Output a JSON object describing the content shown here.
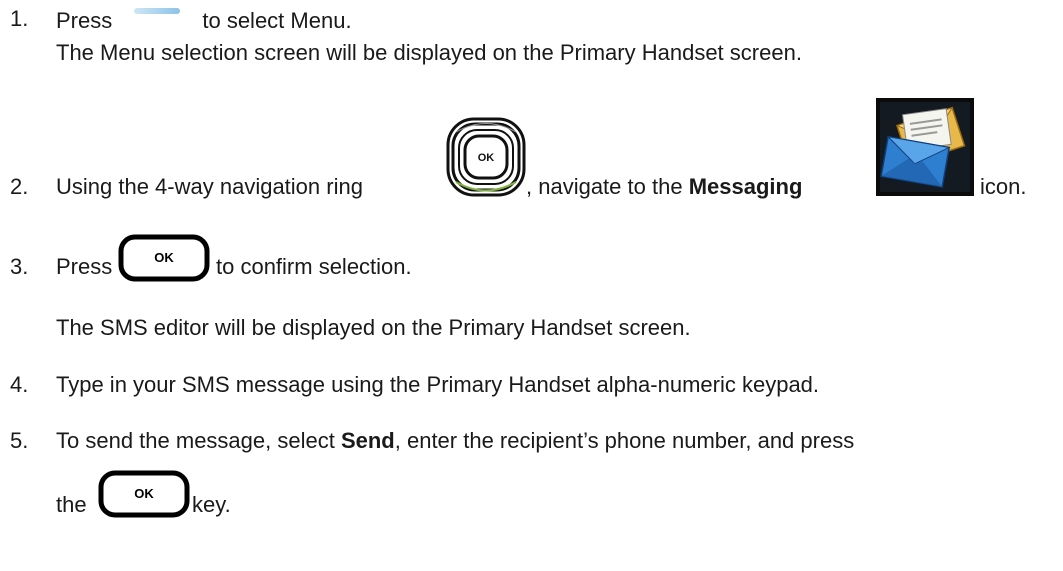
{
  "steps": [
    {
      "number": "1.",
      "before": "Press",
      "after": " to select Menu.",
      "icon": "softkey-icon",
      "sub": "The Menu selection screen will be displayed on the Primary Handset screen."
    },
    {
      "number": "2.",
      "before": "Using the 4-way navigation ring",
      "after_comma": ", navigate to the",
      "bold": "Messaging",
      "after": "icon.",
      "icons": [
        "nav-ring-icon",
        "messaging-icon"
      ],
      "nav_ring_label": "OK"
    },
    {
      "number": "3.",
      "before": "Press",
      "after": "to confirm selection.",
      "icon": "ok-key-icon",
      "ok_label": "OK",
      "sub": "The SMS editor will be displayed on the Primary Handset screen."
    },
    {
      "number": "4.",
      "text": "Type in your SMS message using the Primary Handset alpha-numeric keypad."
    },
    {
      "number": "5.",
      "before": "To send the message, select",
      "bold": "Send",
      "after": ", enter the recipient’s phone number, and press",
      "line2_before": "the",
      "line2_after": "key.",
      "icon": "ok-key-icon",
      "ok_label": "OK"
    }
  ],
  "colors": {
    "text": "#1a1a1a",
    "softkey": "#a9d3ee",
    "messaging_bg": "#0b0b0b",
    "envelope_blue": "#2f7fd0",
    "envelope_gold": "#e2a63a"
  }
}
